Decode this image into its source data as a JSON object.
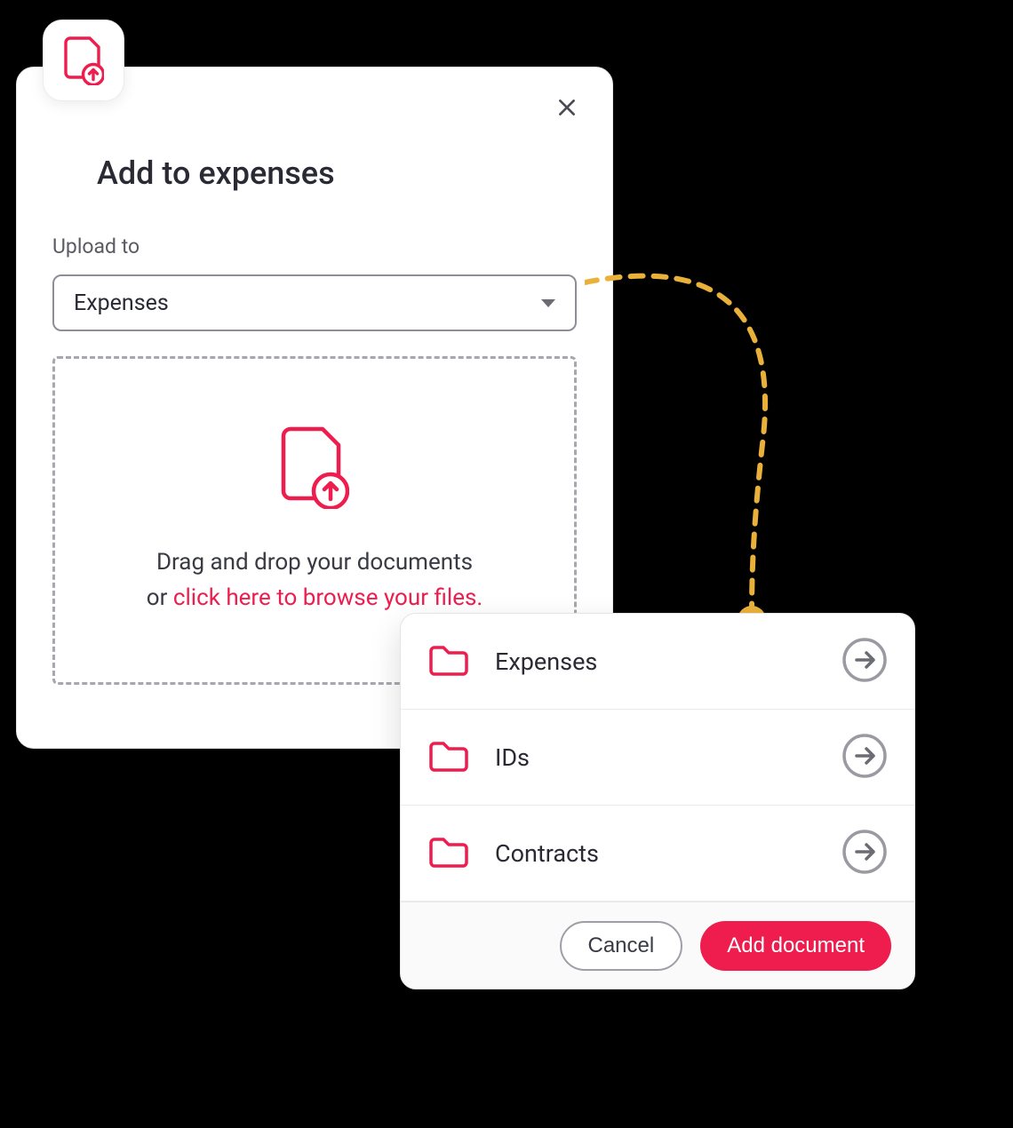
{
  "colors": {
    "accent": "#ee1d4e",
    "connector": "#eab13a",
    "text_dark": "#2a2a34",
    "text_muted": "#6b6b74",
    "border_muted": "#a0a0a8"
  },
  "dialog": {
    "title": "Add to expenses",
    "upload_label": "Upload to",
    "select_value": "Expenses",
    "dropzone": {
      "line1": "Drag and drop your documents",
      "line2_prefix": "or ",
      "link_text": "click here to browse your files."
    }
  },
  "popup": {
    "items": [
      {
        "label": "Expenses"
      },
      {
        "label": "IDs"
      },
      {
        "label": "Contracts"
      }
    ],
    "cancel_label": "Cancel",
    "submit_label": "Add document"
  }
}
